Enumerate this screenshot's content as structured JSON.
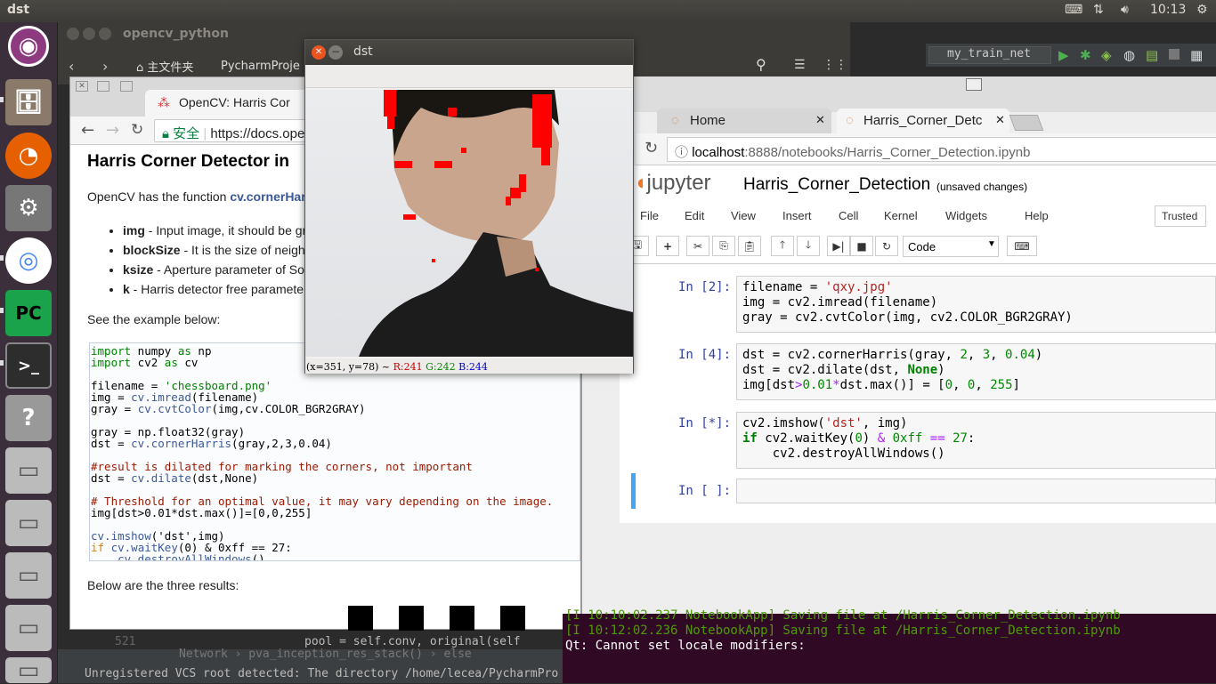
{
  "top_panel": {
    "title": "dst",
    "clock": "10:13"
  },
  "pycharm": {
    "run_config": "my_train_net",
    "path_items": [
      "Network",
      "pva_inception_res_stack()",
      "else"
    ],
    "line_no": "521",
    "code_line": "pool = self.conv, original(self",
    "status": "Unregistered VCS root detected: The directory /home/lecea/PycharmPro"
  },
  "nautilus": {
    "title": "opencv_python",
    "home_label": "主文件夹",
    "folder": "PycharmProje"
  },
  "docs": {
    "tab_title": "OpenCV: Harris Cor",
    "secure_label": "安全",
    "url": "https://docs.ope",
    "heading": "Harris Corner Detector in",
    "intro_pre": "OpenCV has the function ",
    "intro_func": "cv.cornerHar",
    "bullets": [
      {
        "b": "img",
        "t": " - Input image, it should be gr"
      },
      {
        "b": "blockSize",
        "t": " - It is the size of neigh"
      },
      {
        "b": "ksize",
        "t": " - Aperture parameter of So"
      },
      {
        "b": "k",
        "t": " - Harris detector free paramete"
      }
    ],
    "example": "See the example below:",
    "results": "Below are the three results:"
  },
  "dst_window": {
    "title": "dst",
    "status_coords": "(x=351, y=78) ~",
    "r": "R:241",
    "g": "G:242",
    "b": "B:244"
  },
  "jupyter": {
    "tabs": [
      "Home",
      "Harris_Corner_Detc"
    ],
    "url_host": "localhost",
    "url_rest": ":8888/notebooks/Harris_Corner_Detection.ipynb",
    "logo": "jupyter",
    "notebook_name": "Harris_Corner_Detection",
    "unsaved": "(unsaved changes)",
    "menu": [
      "File",
      "Edit",
      "View",
      "Insert",
      "Cell",
      "Kernel",
      "Widgets",
      "Help"
    ],
    "trusted": "Trusted",
    "cell_type": "Code",
    "prompts": [
      "In [2]:",
      "In [4]:",
      "In [*]:",
      "In [ ]:"
    ]
  },
  "terminal": {
    "lines": [
      "[I 10:10:02.237 NotebookApp] Saving file at /Harris_Corner_Detection.ipynb",
      "[I 10:12:02.236 NotebookApp] Saving file at /Harris_Corner_Detection.ipynb",
      "Qt: Cannot set locale modifiers:"
    ]
  }
}
